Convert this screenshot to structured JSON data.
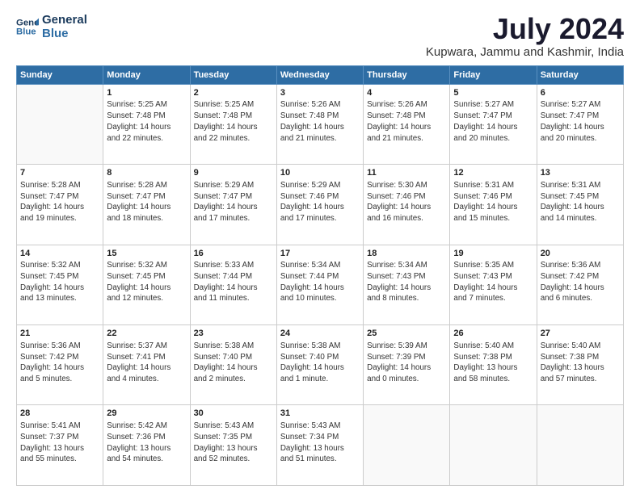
{
  "logo": {
    "line1": "General",
    "line2": "Blue"
  },
  "title": "July 2024",
  "subtitle": "Kupwara, Jammu and Kashmir, India",
  "weekdays": [
    "Sunday",
    "Monday",
    "Tuesday",
    "Wednesday",
    "Thursday",
    "Friday",
    "Saturday"
  ],
  "weeks": [
    [
      {
        "day": "",
        "info": ""
      },
      {
        "day": "1",
        "info": "Sunrise: 5:25 AM\nSunset: 7:48 PM\nDaylight: 14 hours\nand 22 minutes."
      },
      {
        "day": "2",
        "info": "Sunrise: 5:25 AM\nSunset: 7:48 PM\nDaylight: 14 hours\nand 22 minutes."
      },
      {
        "day": "3",
        "info": "Sunrise: 5:26 AM\nSunset: 7:48 PM\nDaylight: 14 hours\nand 21 minutes."
      },
      {
        "day": "4",
        "info": "Sunrise: 5:26 AM\nSunset: 7:48 PM\nDaylight: 14 hours\nand 21 minutes."
      },
      {
        "day": "5",
        "info": "Sunrise: 5:27 AM\nSunset: 7:47 PM\nDaylight: 14 hours\nand 20 minutes."
      },
      {
        "day": "6",
        "info": "Sunrise: 5:27 AM\nSunset: 7:47 PM\nDaylight: 14 hours\nand 20 minutes."
      }
    ],
    [
      {
        "day": "7",
        "info": "Sunrise: 5:28 AM\nSunset: 7:47 PM\nDaylight: 14 hours\nand 19 minutes."
      },
      {
        "day": "8",
        "info": "Sunrise: 5:28 AM\nSunset: 7:47 PM\nDaylight: 14 hours\nand 18 minutes."
      },
      {
        "day": "9",
        "info": "Sunrise: 5:29 AM\nSunset: 7:47 PM\nDaylight: 14 hours\nand 17 minutes."
      },
      {
        "day": "10",
        "info": "Sunrise: 5:29 AM\nSunset: 7:46 PM\nDaylight: 14 hours\nand 17 minutes."
      },
      {
        "day": "11",
        "info": "Sunrise: 5:30 AM\nSunset: 7:46 PM\nDaylight: 14 hours\nand 16 minutes."
      },
      {
        "day": "12",
        "info": "Sunrise: 5:31 AM\nSunset: 7:46 PM\nDaylight: 14 hours\nand 15 minutes."
      },
      {
        "day": "13",
        "info": "Sunrise: 5:31 AM\nSunset: 7:45 PM\nDaylight: 14 hours\nand 14 minutes."
      }
    ],
    [
      {
        "day": "14",
        "info": "Sunrise: 5:32 AM\nSunset: 7:45 PM\nDaylight: 14 hours\nand 13 minutes."
      },
      {
        "day": "15",
        "info": "Sunrise: 5:32 AM\nSunset: 7:45 PM\nDaylight: 14 hours\nand 12 minutes."
      },
      {
        "day": "16",
        "info": "Sunrise: 5:33 AM\nSunset: 7:44 PM\nDaylight: 14 hours\nand 11 minutes."
      },
      {
        "day": "17",
        "info": "Sunrise: 5:34 AM\nSunset: 7:44 PM\nDaylight: 14 hours\nand 10 minutes."
      },
      {
        "day": "18",
        "info": "Sunrise: 5:34 AM\nSunset: 7:43 PM\nDaylight: 14 hours\nand 8 minutes."
      },
      {
        "day": "19",
        "info": "Sunrise: 5:35 AM\nSunset: 7:43 PM\nDaylight: 14 hours\nand 7 minutes."
      },
      {
        "day": "20",
        "info": "Sunrise: 5:36 AM\nSunset: 7:42 PM\nDaylight: 14 hours\nand 6 minutes."
      }
    ],
    [
      {
        "day": "21",
        "info": "Sunrise: 5:36 AM\nSunset: 7:42 PM\nDaylight: 14 hours\nand 5 minutes."
      },
      {
        "day": "22",
        "info": "Sunrise: 5:37 AM\nSunset: 7:41 PM\nDaylight: 14 hours\nand 4 minutes."
      },
      {
        "day": "23",
        "info": "Sunrise: 5:38 AM\nSunset: 7:40 PM\nDaylight: 14 hours\nand 2 minutes."
      },
      {
        "day": "24",
        "info": "Sunrise: 5:38 AM\nSunset: 7:40 PM\nDaylight: 14 hours\nand 1 minute."
      },
      {
        "day": "25",
        "info": "Sunrise: 5:39 AM\nSunset: 7:39 PM\nDaylight: 14 hours\nand 0 minutes."
      },
      {
        "day": "26",
        "info": "Sunrise: 5:40 AM\nSunset: 7:38 PM\nDaylight: 13 hours\nand 58 minutes."
      },
      {
        "day": "27",
        "info": "Sunrise: 5:40 AM\nSunset: 7:38 PM\nDaylight: 13 hours\nand 57 minutes."
      }
    ],
    [
      {
        "day": "28",
        "info": "Sunrise: 5:41 AM\nSunset: 7:37 PM\nDaylight: 13 hours\nand 55 minutes."
      },
      {
        "day": "29",
        "info": "Sunrise: 5:42 AM\nSunset: 7:36 PM\nDaylight: 13 hours\nand 54 minutes."
      },
      {
        "day": "30",
        "info": "Sunrise: 5:43 AM\nSunset: 7:35 PM\nDaylight: 13 hours\nand 52 minutes."
      },
      {
        "day": "31",
        "info": "Sunrise: 5:43 AM\nSunset: 7:34 PM\nDaylight: 13 hours\nand 51 minutes."
      },
      {
        "day": "",
        "info": ""
      },
      {
        "day": "",
        "info": ""
      },
      {
        "day": "",
        "info": ""
      }
    ]
  ]
}
